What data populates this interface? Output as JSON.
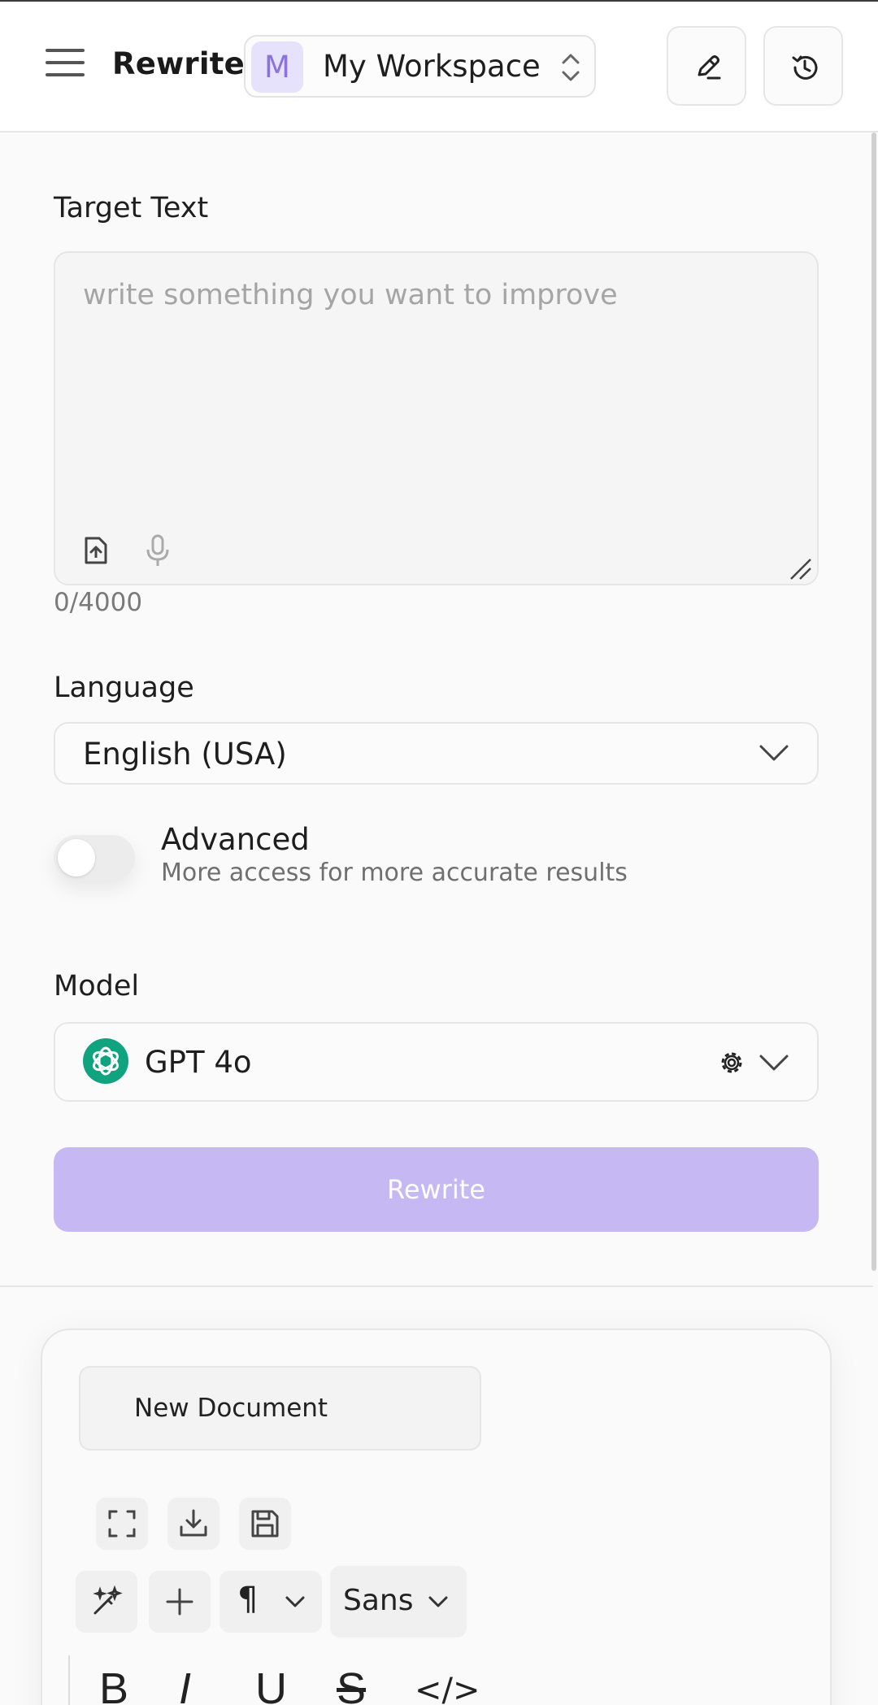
{
  "header": {
    "title": "Rewrite",
    "workspace": {
      "avatar_letter": "M",
      "name": "My Workspace"
    },
    "icons": [
      "menu-icon",
      "edit-pen-icon",
      "history-icon",
      "chevron-up-down-icon"
    ]
  },
  "form": {
    "target_label": "Target Text",
    "target_placeholder": "write something you want to improve",
    "target_value": "",
    "char_counter": "0/4000",
    "language_label": "Language",
    "language_value": "English (USA)",
    "advanced_title": "Advanced",
    "advanced_desc": "More access for more accurate results",
    "advanced_enabled": false,
    "model_label": "Model",
    "model_value": "GPT 4o",
    "submit_label": "Rewrite"
  },
  "editor": {
    "doc_title": "New Document",
    "paragraph_symbol": "¶",
    "font_value": "Sans",
    "format_buttons": [
      "B",
      "I",
      "U",
      "S",
      "</>"
    ]
  },
  "colors": {
    "accent": "#c5b8f3",
    "workspace_avatar_bg": "#e7e2fb",
    "workspace_avatar_fg": "#8a72df",
    "model_logo": "#10a37f"
  }
}
